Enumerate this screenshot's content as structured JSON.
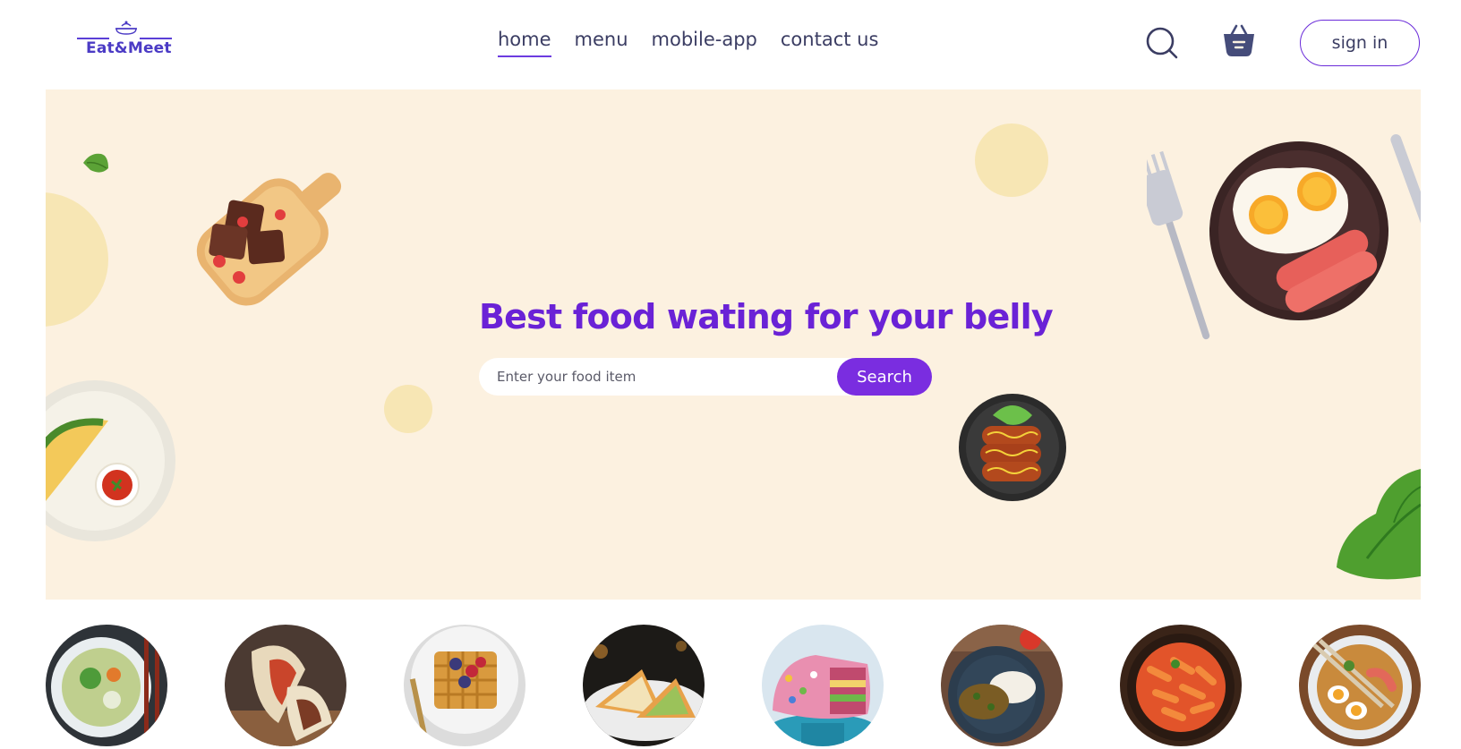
{
  "header": {
    "logo_text": "Eat&Meet",
    "nav": [
      {
        "label": "home",
        "active": true
      },
      {
        "label": "menu",
        "active": false
      },
      {
        "label": "mobile-app",
        "active": false
      },
      {
        "label": "contact us",
        "active": false
      }
    ],
    "search_icon": "search-icon",
    "basket_icon": "basket-icon",
    "signin_label": "sign in"
  },
  "hero": {
    "title": "Best food wating for your belly",
    "search_placeholder": "Enter your food item",
    "search_button": "Search"
  },
  "categories": [
    "salad-bowl",
    "wrap",
    "waffle",
    "sandwich",
    "cake",
    "curry-rice",
    "pasta",
    "ramen"
  ],
  "colors": {
    "brand": "#7a2de0",
    "hero_bg": "#fcf1e0",
    "blob": "#f7e6b4",
    "text": "#3b3d63"
  }
}
